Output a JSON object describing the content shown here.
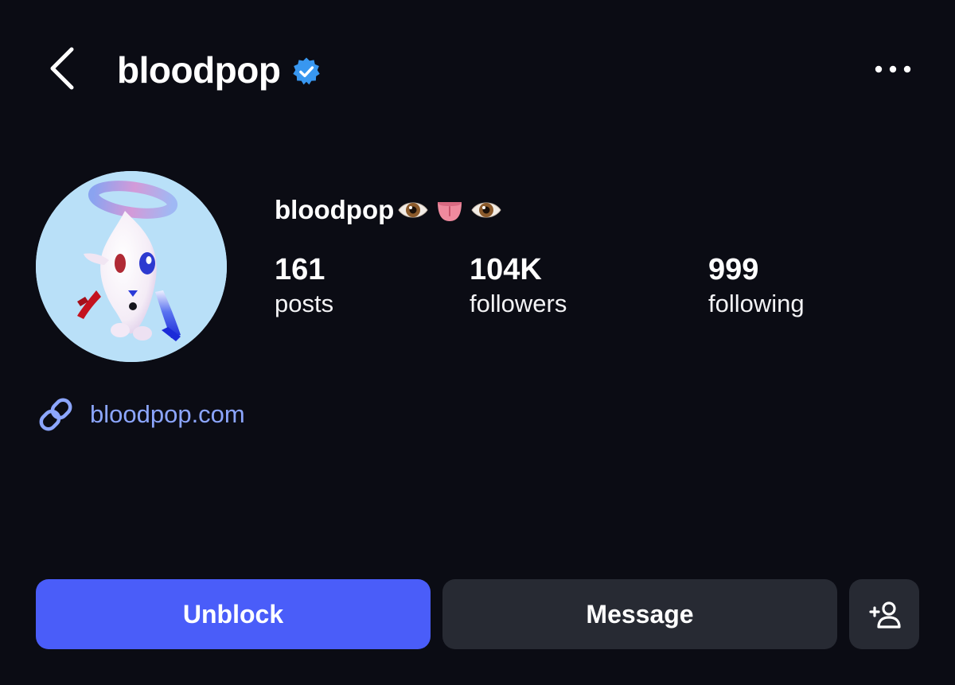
{
  "header": {
    "back_icon": "chevron-left-icon",
    "username": "bloodpop",
    "verified_icon": "verified-badge-icon",
    "more_icon": "more-horizontal-icon"
  },
  "profile": {
    "display_name": "bloodpop",
    "name_emojis": [
      "eye-emoji",
      "tongue-emoji",
      "eye-emoji"
    ],
    "avatar": "cartoon-ghost-with-halo-avatar"
  },
  "stats": {
    "posts": {
      "value": "161",
      "label": "posts"
    },
    "followers": {
      "value": "104K",
      "label": "followers"
    },
    "following": {
      "value": "999",
      "label": "following"
    }
  },
  "bio": {
    "link_icon": "link-icon",
    "link_text": "bloodpop.com"
  },
  "actions": {
    "unblock_label": "Unblock",
    "message_label": "Message",
    "add_person_icon": "add-person-icon"
  },
  "colors": {
    "background": "#0b0c14",
    "primary_button": "#4a5df9",
    "secondary_button": "#272a33",
    "link": "#8ca6ff",
    "verified": "#3897f0"
  }
}
